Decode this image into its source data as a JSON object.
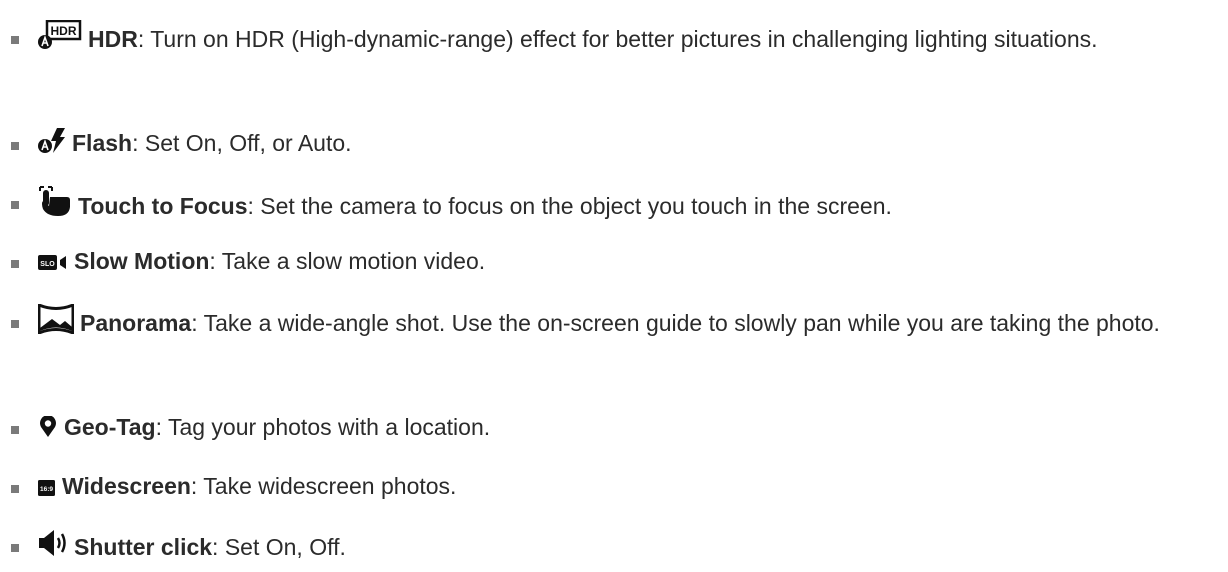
{
  "items": [
    {
      "icon": "hdr-icon",
      "term": "HDR",
      "sep": ": ",
      "desc": "Turn on HDR (High-dynamic-range) effect for better pictures in challenging lighting situations."
    },
    {
      "icon": "flash-auto-icon",
      "term": "Flash",
      "sep": ": ",
      "desc": "Set On, Off, or Auto."
    },
    {
      "icon": "touch-focus-icon",
      "term": "Touch to Focus",
      "sep": ": ",
      "desc": "Set the camera to focus on the object you touch in the screen."
    },
    {
      "icon": "slow-motion-icon",
      "term": "Slow Motion",
      "sep": ": ",
      "desc": "Take a slow motion video.",
      "icon_label": "SLO"
    },
    {
      "icon": "panorama-icon",
      "term": "Panorama",
      "sep": ": ",
      "desc": "Take a wide-angle shot. Use the on-screen guide to slowly pan while you are taking the photo."
    },
    {
      "icon": "geo-tag-icon",
      "term": "Geo-Tag",
      "sep": ": ",
      "desc": "Tag your photos with a location."
    },
    {
      "icon": "widescreen-icon",
      "term": "Widescreen",
      "sep": ": ",
      "desc": "Take widescreen photos.",
      "icon_label": "16:9"
    },
    {
      "icon": "speaker-icon",
      "term": "Shutter click",
      "sep": ": ",
      "desc": "Set On, Off."
    }
  ],
  "colors": {
    "text": "#2b2b2b",
    "icon": "#111111",
    "bullet": "#7a7a7a"
  }
}
